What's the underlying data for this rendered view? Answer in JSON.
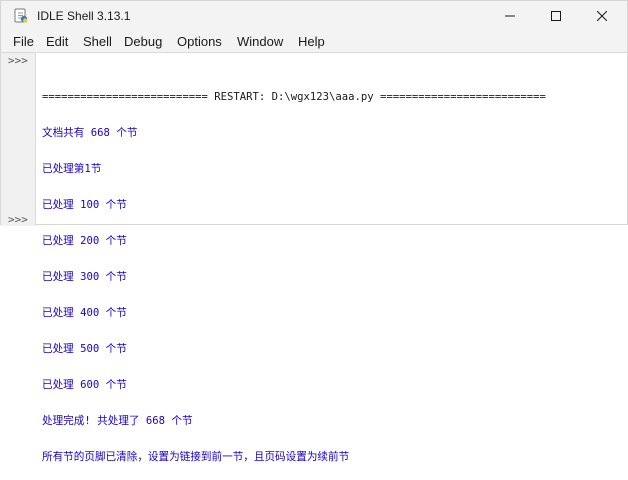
{
  "window": {
    "title": "IDLE Shell 3.13.1"
  },
  "menu": {
    "items": [
      "File",
      "Edit",
      "Shell",
      "Debug",
      "Options",
      "Window",
      "Help"
    ]
  },
  "gutter": {
    "prompt_top": ">>>",
    "prompt_bottom": ">>>"
  },
  "output": {
    "restart_line": "========================== RESTART: D:\\wgx123\\aaa.py ==========================",
    "lines": [
      "文档共有 668 个节",
      "已处理第1节",
      "已处理 100 个节",
      "已处理 200 个节",
      "已处理 300 个节",
      "已处理 400 个节",
      "已处理 500 个节",
      "已处理 600 个节",
      "处理完成! 共处理了 668 个节",
      "所有节的页脚已清除，设置为链接到前一节，且页码设置为续前节"
    ]
  },
  "colors": {
    "stdout": "#1b00c6",
    "restart": "#1a1a1a",
    "titlebar": "#f3f3f3",
    "gutter": "#f0f0f0"
  },
  "icons": {
    "app": "idle-python-icon",
    "minimize": "minimize-icon",
    "maximize": "maximize-icon",
    "close": "close-icon"
  }
}
